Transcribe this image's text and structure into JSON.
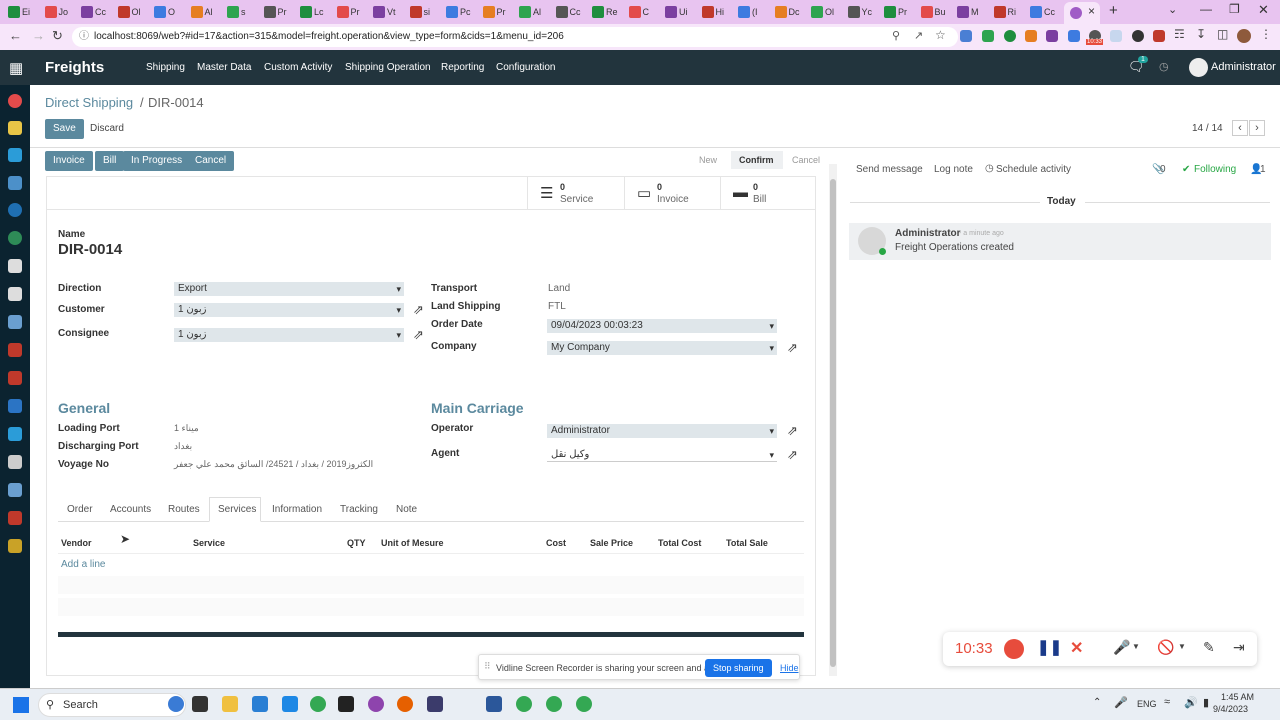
{
  "browser": {
    "tabs": [
      "Ei",
      "Jo",
      "Cc",
      "Ol",
      "O",
      "Al",
      "s",
      "Pr",
      "Lc",
      "Pr",
      "Vt",
      "si",
      "Pc",
      "Pr",
      "Al",
      "Cc",
      "Re",
      "C",
      "Ui",
      "Hi",
      "(I",
      "Dc",
      "Ol",
      "Yc",
      "Pr",
      "Bu",
      "M",
      "Ri",
      "Cc"
    ],
    "active_tab_label": "C",
    "active_tab_close": "×",
    "new_tab": "+",
    "url": "localhost:8069/web?#id=17&action=315&model=freight.operation&view_type=form&cids=1&menu_id=206",
    "rec_badge": "10:33"
  },
  "app": {
    "title": "Freights",
    "menu": [
      "Shipping",
      "Master Data",
      "Custom Activity",
      "Shipping Operation",
      "Reporting",
      "Configuration"
    ],
    "chat_badge": "1",
    "user": "Administrator"
  },
  "breadcrumb": {
    "parent": "Direct Shipping",
    "sep": "/",
    "current": "DIR-0014"
  },
  "control": {
    "save": "Save",
    "discard": "Discard",
    "pager": "14 / 14"
  },
  "header_buttons": [
    "Invoice",
    "Bill",
    "In Progress",
    "Cancel"
  ],
  "statusbar": [
    "New",
    "Confirm",
    "Cancel"
  ],
  "smart_buttons": [
    {
      "count": "0",
      "label": "Service"
    },
    {
      "count": "0",
      "label": "Invoice"
    },
    {
      "count": "0",
      "label": "Bill"
    }
  ],
  "form": {
    "name_label": "Name",
    "name": "DIR-0014",
    "direction_label": "Direction",
    "direction": "Export",
    "customer_label": "Customer",
    "customer": "زبون 1",
    "consignee_label": "Consignee",
    "consignee": "زبون 1",
    "transport_label": "Transport",
    "transport": "Land",
    "land_label": "Land Shipping",
    "land": "FTL",
    "order_date_label": "Order Date",
    "order_date": "09/04/2023 00:03:23",
    "company_label": "Company",
    "company": "My Company",
    "general": "General",
    "loading_label": "Loading Port",
    "loading": "ميناء 1",
    "discharging_label": "Discharging Port",
    "discharging": "بغداد",
    "voyage_label": "Voyage No",
    "voyage": "الكثروز2019 / بغداد / 24521/ السائق محمد علي جعفر",
    "main_carriage": "Main Carriage",
    "operator_label": "Operator",
    "operator": "Administrator",
    "agent_label": "Agent",
    "agent": "وكيل نقل"
  },
  "notebook": {
    "tabs": [
      "Order",
      "Accounts",
      "Routes",
      "Services",
      "Information",
      "Tracking",
      "Note"
    ],
    "columns": [
      "Vendor",
      "Service",
      "QTY",
      "Unit of Mesure",
      "Cost",
      "Sale Price",
      "Total Cost",
      "Total Sale"
    ],
    "add_line": "Add a line"
  },
  "chatter": {
    "send": "Send message",
    "log": "Log note",
    "schedule": "Schedule activity",
    "attachments": "0",
    "following": "Following",
    "followers": "1",
    "today": "Today",
    "author": "Administrator",
    "time": "- a minute ago",
    "message": "Freight Operations created"
  },
  "share_bar": {
    "text": "Vidline Screen Recorder is sharing your screen and audio.",
    "stop": "Stop sharing",
    "hide": "Hide"
  },
  "recorder": {
    "time": "10:33"
  },
  "taskbar": {
    "search": "Search",
    "lang": "ENG",
    "time": "1:45 AM",
    "date": "9/4/2023"
  },
  "colors": {
    "accent": "#5b899e",
    "navbar": "#22343d",
    "sidebar": "#0b2330",
    "record": "#e74c3c",
    "chrome": "#e8c4f0"
  }
}
